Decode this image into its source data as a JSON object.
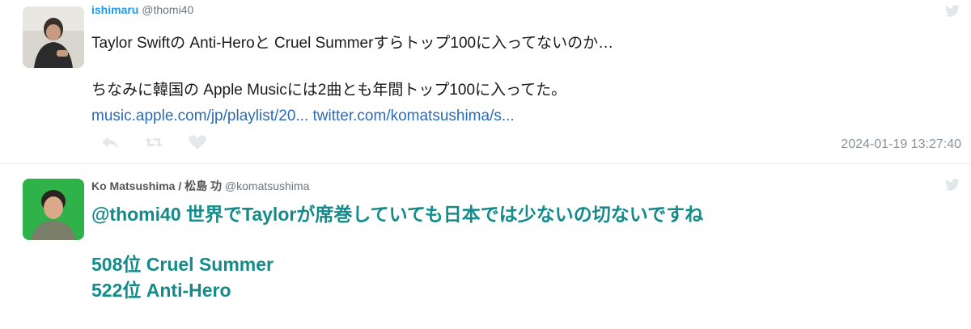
{
  "tweets": [
    {
      "name": "ishimaru",
      "handle": "@thomi40",
      "text_line1": "Taylor Swiftの Anti-Heroと Cruel Summerすらトップ100に入ってないのか…",
      "text_line2": "ちなみに韓国の Apple Musicには2曲とも年間トップ100に入ってた。",
      "link1": "music.apple.com/jp/playlist/20...",
      "link2": "twitter.com/komatsushima/s...",
      "timestamp": "2024-01-19 13:27:40",
      "actions": [
        "reply-icon",
        "retweet-icon",
        "like-icon"
      ]
    },
    {
      "name": "Ko Matsushima / 松島 功",
      "handle": "@komatsushima",
      "text_line1": "@thomi40 世界でTaylorが席巻していても日本では少ないの切ないですね",
      "text_line2": "508位 Cruel Summer",
      "text_line3": "522位 Anti-Hero"
    }
  ],
  "colors": {
    "name_link": "#1d9bf0",
    "link": "#2a6cb8",
    "highlight_text": "#138b8b",
    "muted": "#8a9299"
  }
}
